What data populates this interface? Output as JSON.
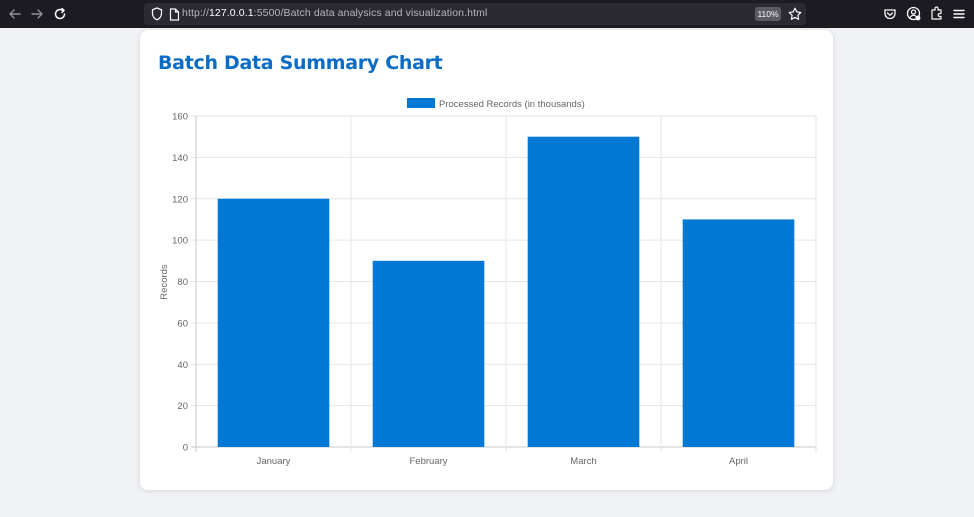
{
  "browser": {
    "url_scheme": "http://",
    "url_host": "127.0.0.1",
    "url_rest": ":5500/Batch data analysics and visualization.html",
    "zoom": "110%"
  },
  "page": {
    "title": "Batch Data Summary Chart"
  },
  "chart_data": {
    "type": "bar",
    "categories": [
      "January",
      "February",
      "March",
      "April"
    ],
    "series": [
      {
        "name": "Processed Records (in thousands)",
        "values": [
          120,
          90,
          150,
          110
        ],
        "color": "#0078d4"
      }
    ],
    "ylabel": "Records",
    "ylim": [
      0,
      160
    ],
    "yticks": [
      0,
      20,
      40,
      60,
      80,
      100,
      120,
      140,
      160
    ],
    "grid": true,
    "legend": "top"
  },
  "colors": {
    "accent": "#0a6cc4",
    "bar": "#0078d4"
  }
}
